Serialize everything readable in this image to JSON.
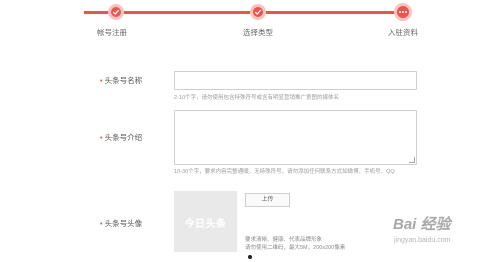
{
  "stepper": {
    "steps": [
      {
        "label": "帐号注册",
        "state": "done"
      },
      {
        "label": "选择类型",
        "state": "done"
      },
      {
        "label": "入驻资料",
        "state": "current"
      }
    ],
    "active_color": "#e8554e"
  },
  "form": {
    "name": {
      "required_mark": "•",
      "label": "头条号名称",
      "value": "",
      "hint": "2-10个字，请勿使用包含特殊符号或含有明显营销推广意图的媒体名"
    },
    "intro": {
      "required_mark": "•",
      "label": "头条号介绍",
      "value": "",
      "hint": "10-30个字，要求内容完整通顺，无特殊符号，请勿添加任何联系方式如微博、手机号、QQ"
    },
    "avatar": {
      "required_mark": "•",
      "label": "头条号头像",
      "placeholder_text": "今日头条",
      "upload_label": "上传",
      "hint_line1": "要求清晰、健康、代表品牌形象",
      "hint_line2": "请勿使用二维码，最大5M，200x200像素"
    }
  },
  "watermark": {
    "main": "Bai 经验",
    "sub": "jingyan.baidu.com"
  }
}
